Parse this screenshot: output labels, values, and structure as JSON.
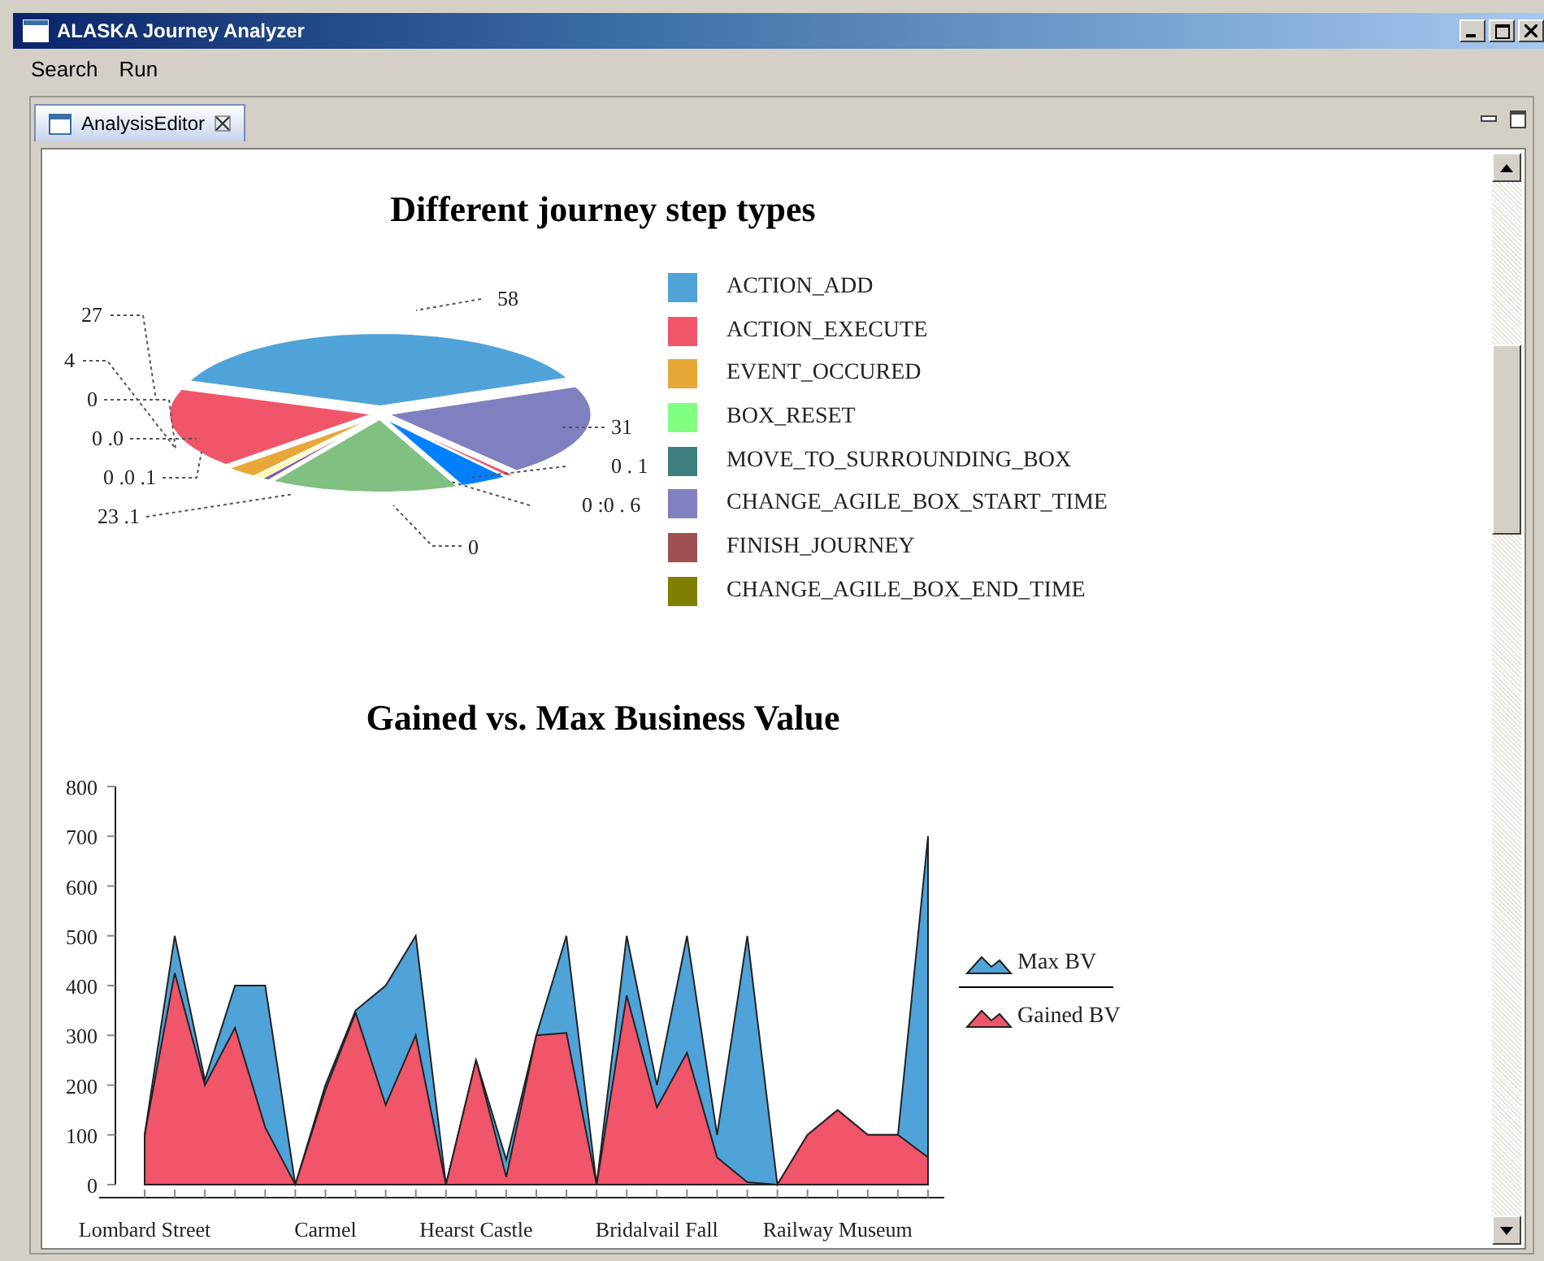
{
  "window": {
    "title": "ALASKA Journey Analyzer"
  },
  "menu": [
    "Search",
    "Run"
  ],
  "tabs": [
    {
      "label": "AnalysisEditor",
      "selected": true
    }
  ],
  "pie_chart": {
    "title": "Different journey step types",
    "value_labels": [
      "58",
      "27",
      "4",
      "0",
      "0 .0",
      "0 .0 .1",
      "23 .1",
      "31",
      "0 . 1",
      "0 :0 . 6",
      "0"
    ],
    "legend": [
      {
        "label": "ACTION_ADD",
        "color": "#4fa3d8"
      },
      {
        "label": "ACTION_EXECUTE",
        "color": "#f0556a"
      },
      {
        "label": "EVENT_OCCURED",
        "color": "#e8a838"
      },
      {
        "label": "BOX_RESET",
        "color": "#80ff80"
      },
      {
        "label": "MOVE_TO_SURROUNDING_BOX",
        "color": "#3f7f7f"
      },
      {
        "label": "CHANGE_AGILE_BOX_START_TIME",
        "color": "#8080c0"
      },
      {
        "label": "FINISH_JOURNEY",
        "color": "#a05050"
      },
      {
        "label": "CHANGE_AGILE_BOX_END_TIME",
        "color": "#808000"
      }
    ]
  },
  "area_chart": {
    "chart_data": {
      "type": "area",
      "title": "Gained vs. Max Business Value",
      "stacked": false,
      "categories": [
        "Lombard Street",
        null,
        null,
        null,
        null,
        null,
        "Carmel",
        null,
        null,
        null,
        null,
        "Hearst Castle",
        null,
        null,
        null,
        null,
        null,
        "Bridalvail Fall",
        null,
        null,
        null,
        null,
        null,
        "Railway Museum",
        null,
        null,
        null
      ],
      "ylim": [
        0,
        800
      ],
      "yticks": [
        0,
        100,
        200,
        300,
        400,
        500,
        600,
        700,
        800
      ],
      "series": [
        {
          "name": "Max BV",
          "color": "#4fa3d8",
          "values": [
            100,
            500,
            210,
            400,
            400,
            0,
            200,
            350,
            400,
            500,
            0,
            250,
            50,
            300,
            500,
            0,
            500,
            200,
            500,
            100,
            500,
            0,
            100,
            150,
            100,
            100,
            700
          ]
        },
        {
          "name": "Gained BV",
          "color": "#f0556a",
          "values": [
            100,
            425,
            200,
            315,
            115,
            0,
            190,
            345,
            160,
            300,
            0,
            250,
            15,
            300,
            305,
            0,
            380,
            155,
            265,
            55,
            5,
            0,
            100,
            150,
            100,
            100,
            55
          ]
        }
      ]
    }
  }
}
